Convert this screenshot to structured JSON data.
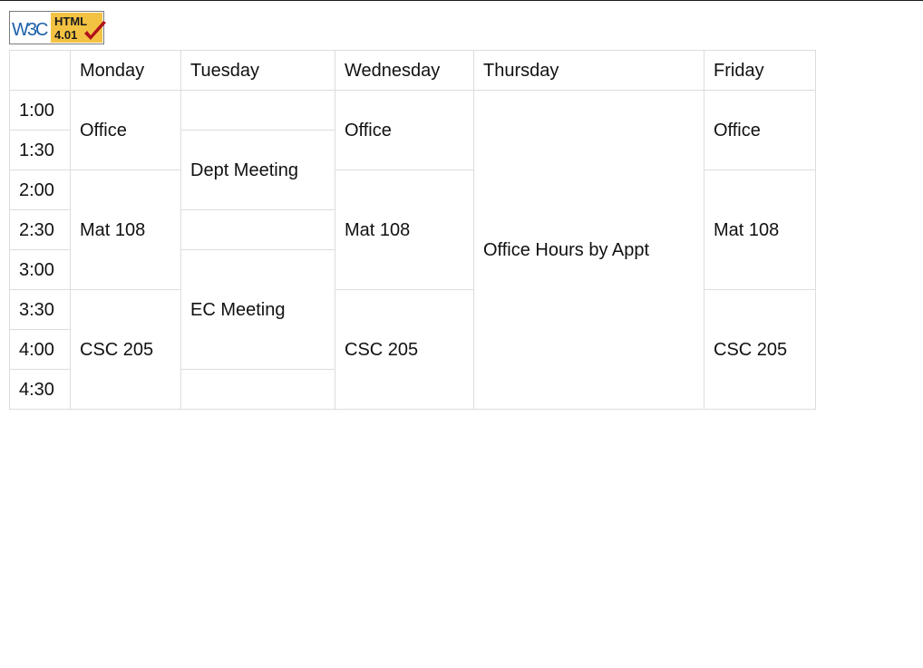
{
  "badge": {
    "w3c_text": "W3C",
    "html_text": "HTML",
    "version_text": "4.01"
  },
  "schedule": {
    "header": {
      "corner": "",
      "days": [
        "Monday",
        "Tuesday",
        "Wednesday",
        "Thursday",
        "Friday"
      ]
    },
    "times": [
      "1:00",
      "1:30",
      "2:00",
      "2:30",
      "3:00",
      "3:30",
      "4:00",
      "4:30"
    ],
    "monday": {
      "office": "Office",
      "mat": "Mat 108",
      "csc": "CSC 205"
    },
    "tuesday": {
      "empty_1": "",
      "dept": "Dept Meeting",
      "empty_2": "",
      "ec": "EC Meeting",
      "empty_3": ""
    },
    "wednesday": {
      "office": "Office",
      "mat": "Mat 108",
      "csc": "CSC 205"
    },
    "thursday": {
      "hours": "Office Hours by Appt"
    },
    "friday": {
      "office": "Office",
      "mat": "Mat 108",
      "csc": "CSC 205"
    }
  },
  "colors": {
    "badge_blue": "#1b5fa8",
    "badge_gold": "#f4c243",
    "check_red": "#b0121b",
    "grid_line": "#dddddd"
  }
}
